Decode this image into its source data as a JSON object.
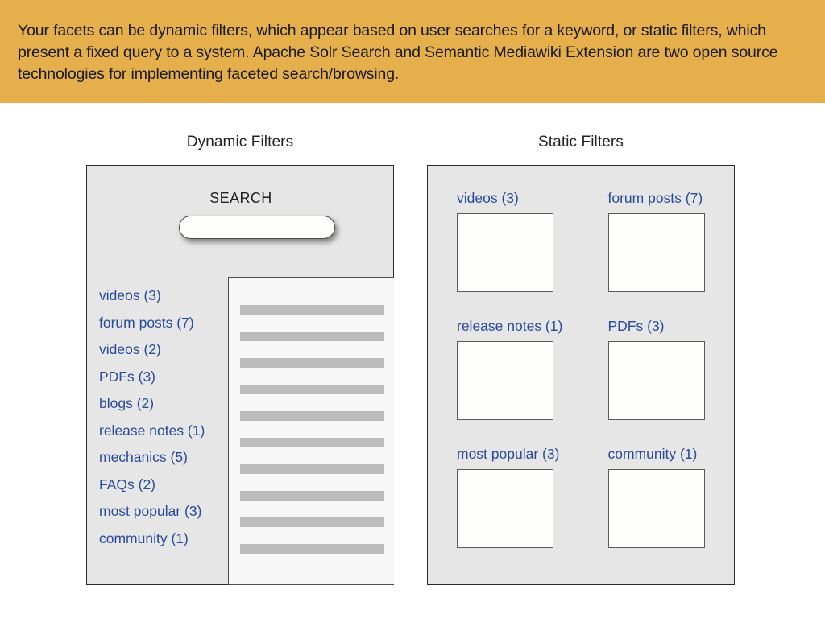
{
  "header": {
    "text": "Your facets can be dynamic filters, which appear based on user searches for a keyword, or static filters, which present a fixed query to a system. Apache Solr Search and Semantic Mediawiki Extension are two open source technologies for implementing faceted search/browsing.",
    "background_color": "#e5b04c"
  },
  "accent_colors": {
    "link_blue": "#2b4a9b",
    "panel_gray": "#e6e6e6",
    "bar_gray": "#bcbcbc",
    "results_bg": "#f7f7f7"
  },
  "dynamic": {
    "title": "Dynamic Filters",
    "search_label": "SEARCH",
    "search_value": "",
    "search_placeholder": "",
    "filters": [
      {
        "label": "videos (3)"
      },
      {
        "label": "forum posts (7)"
      },
      {
        "label": "videos (2)"
      },
      {
        "label": "PDFs (3)"
      },
      {
        "label": "blogs (2)"
      },
      {
        "label": "release notes (1)"
      },
      {
        "label": "mechanics (5)"
      },
      {
        "label": "FAQs (2)"
      },
      {
        "label": "most popular (3)"
      },
      {
        "label": "community (1)"
      }
    ],
    "result_bar_count": 10
  },
  "static": {
    "title": "Static Filters",
    "filters": [
      {
        "label": "videos (3)"
      },
      {
        "label": "forum posts (7)"
      },
      {
        "label": "release notes (1)"
      },
      {
        "label": "PDFs (3)"
      },
      {
        "label": "most popular (3)"
      },
      {
        "label": "community (1)"
      }
    ]
  }
}
